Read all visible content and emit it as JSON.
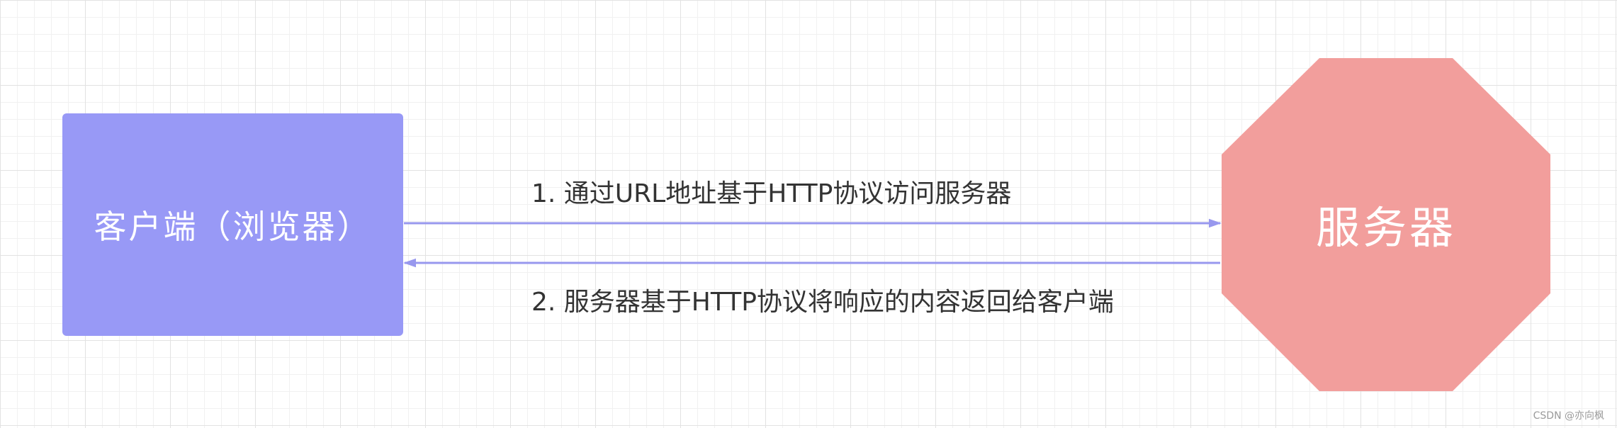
{
  "nodes": {
    "client": {
      "label": "客户端（浏览器）",
      "color": "#9899f6"
    },
    "server": {
      "label": "服务器",
      "color": "#f29e9c"
    }
  },
  "edges": [
    {
      "from": "client",
      "to": "server",
      "label": "1. 通过URL地址基于HTTP协议访问服务器"
    },
    {
      "from": "server",
      "to": "client",
      "label": "2. 服务器基于HTTP协议将响应的内容返回给客户端"
    }
  ],
  "arrow_color": "#9898ee",
  "watermark": "CSDN @亦向枫"
}
